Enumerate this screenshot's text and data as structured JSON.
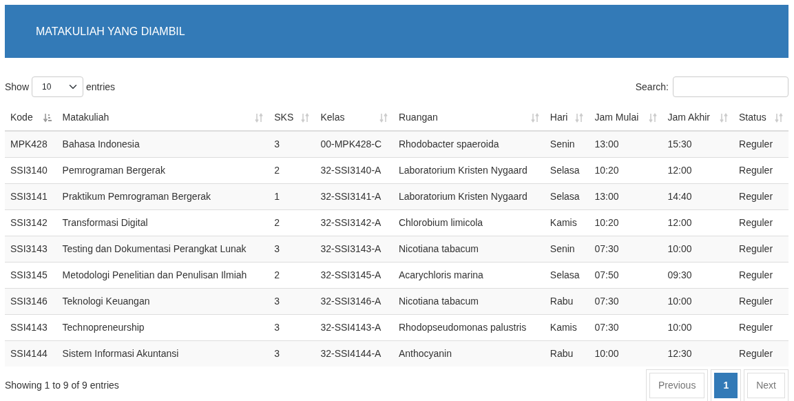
{
  "header": {
    "title": "MATAKULIAH YANG DIAMBIL"
  },
  "length_control": {
    "prefix": "Show",
    "value": "10",
    "suffix": "entries"
  },
  "search": {
    "label": "Search:"
  },
  "table": {
    "columns": [
      {
        "label": "Kode",
        "sorted": true
      },
      {
        "label": "Matakuliah",
        "sorted": false
      },
      {
        "label": "SKS",
        "sorted": false
      },
      {
        "label": "Kelas",
        "sorted": false
      },
      {
        "label": "Ruangan",
        "sorted": false
      },
      {
        "label": "Hari",
        "sorted": false
      },
      {
        "label": "Jam Mulai",
        "sorted": false
      },
      {
        "label": "Jam Akhir",
        "sorted": false
      },
      {
        "label": "Status",
        "sorted": false
      }
    ],
    "rows": [
      [
        "MPK428",
        "Bahasa Indonesia",
        "3",
        "00-MPK428-C",
        "Rhodobacter spaeroida",
        "Senin",
        "13:00",
        "15:30",
        "Reguler"
      ],
      [
        "SSI3140",
        "Pemrograman Bergerak",
        "2",
        "32-SSI3140-A",
        "Laboratorium Kristen Nygaard",
        "Selasa",
        "10:20",
        "12:00",
        "Reguler"
      ],
      [
        "SSI3141",
        "Praktikum Pemrograman Bergerak",
        "1",
        "32-SSI3141-A",
        "Laboratorium Kristen Nygaard",
        "Selasa",
        "13:00",
        "14:40",
        "Reguler"
      ],
      [
        "SSI3142",
        "Transformasi Digital",
        "2",
        "32-SSI3142-A",
        "Chlorobium limicola",
        "Kamis",
        "10:20",
        "12:00",
        "Reguler"
      ],
      [
        "SSI3143",
        "Testing dan Dokumentasi Perangkat Lunak",
        "3",
        "32-SSI3143-A",
        "Nicotiana tabacum",
        "Senin",
        "07:30",
        "10:00",
        "Reguler"
      ],
      [
        "SSI3145",
        "Metodologi Penelitian dan Penulisan Ilmiah",
        "2",
        "32-SSI3145-A",
        "Acarychloris marina",
        "Selasa",
        "07:50",
        "09:30",
        "Reguler"
      ],
      [
        "SSI3146",
        "Teknologi Keuangan",
        "3",
        "32-SSI3146-A",
        "Nicotiana tabacum",
        "Rabu",
        "07:30",
        "10:00",
        "Reguler"
      ],
      [
        "SSI4143",
        "Technopreneurship",
        "3",
        "32-SSI4143-A",
        "Rhodopseudomonas palustris",
        "Kamis",
        "07:30",
        "10:00",
        "Reguler"
      ],
      [
        "SSI4144",
        "Sistem Informasi Akuntansi",
        "3",
        "32-SSI4144-A",
        "Anthocyanin",
        "Rabu",
        "10:00",
        "12:30",
        "Reguler"
      ]
    ]
  },
  "info": "Showing 1 to 9 of 9 entries",
  "pagination": [
    {
      "label": "Previous",
      "selected": false,
      "disabled": true
    },
    {
      "label": "1",
      "selected": true,
      "disabled": false
    },
    {
      "label": "Next",
      "selected": false,
      "disabled": true
    }
  ]
}
